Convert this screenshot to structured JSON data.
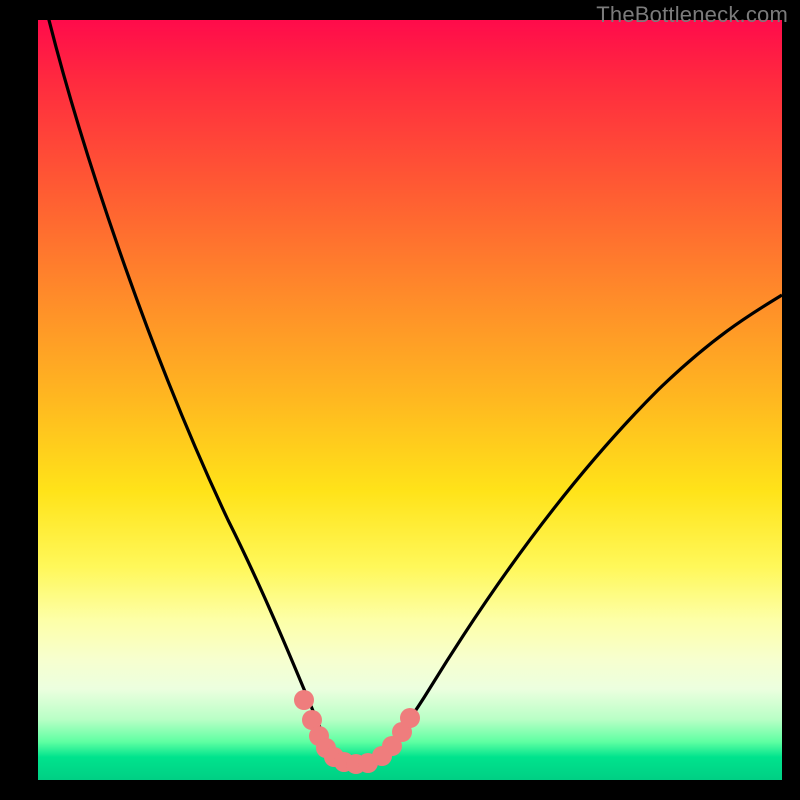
{
  "watermark": "TheBottleneck.com",
  "colors": {
    "curve": "#000000",
    "marker_fill": "#ef7d7d",
    "marker_stroke": "#d46060",
    "frame": "#000000"
  },
  "chart_data": {
    "type": "line",
    "title": "",
    "xlabel": "",
    "ylabel": "",
    "xlim": [
      0,
      100
    ],
    "ylim": [
      0,
      100
    ],
    "grid": false,
    "legend": false,
    "series": [
      {
        "name": "left-curve",
        "x": [
          0,
          4,
          8,
          12,
          16,
          20,
          24,
          27,
          30,
          33,
          35,
          36,
          37.5,
          39,
          40.5,
          42
        ],
        "y": [
          100,
          90,
          80,
          70,
          60,
          50,
          40,
          31,
          23,
          15,
          10,
          7.5,
          5,
          3,
          2,
          2
        ]
      },
      {
        "name": "right-curve",
        "x": [
          42,
          45,
          48,
          52,
          56,
          60,
          65,
          72,
          80,
          90,
          100
        ],
        "y": [
          2,
          3,
          5,
          8,
          12,
          17,
          24,
          33,
          43,
          54,
          64
        ]
      }
    ],
    "markers": {
      "name": "bottleneck-points",
      "x": [
        35.0,
        36.0,
        37.0,
        38.0,
        39.0,
        40.0,
        41.5,
        43.0,
        45.0,
        46.0,
        47.5,
        49.0
      ],
      "y": [
        10.0,
        7.2,
        5.0,
        3.5,
        2.5,
        2.0,
        2.0,
        2.2,
        3.2,
        4.0,
        5.5,
        7.2
      ]
    }
  }
}
